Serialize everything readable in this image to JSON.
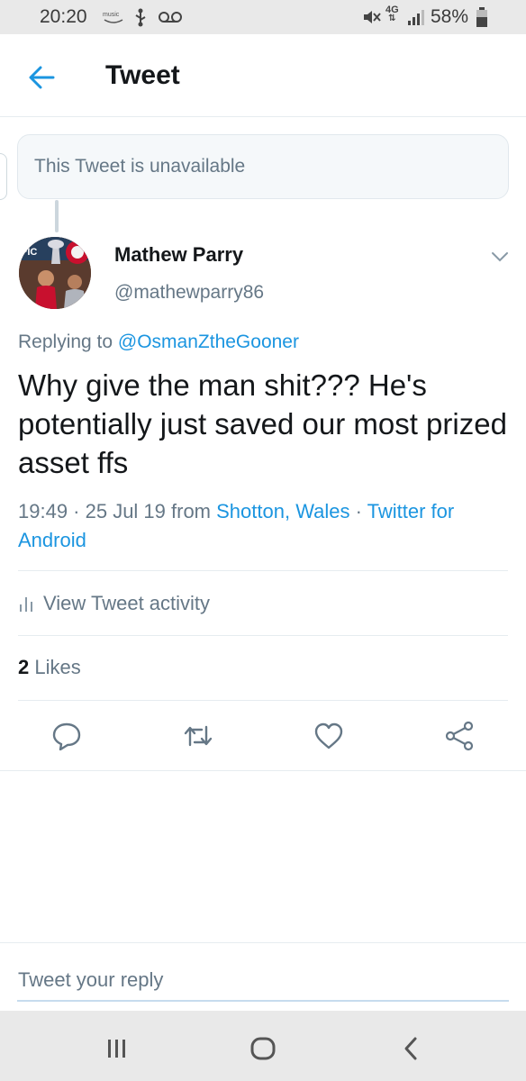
{
  "status_bar": {
    "time": "20:20",
    "network": "4G",
    "battery": "58%",
    "icons": [
      "music-notification-icon",
      "usb-icon",
      "voicemail-icon",
      "mute-icon",
      "signal-icon",
      "battery-icon"
    ]
  },
  "header": {
    "title": "Tweet",
    "back_icon": "arrow-left-icon"
  },
  "parent_tweet": {
    "text": "This Tweet is unavailable"
  },
  "tweet": {
    "author_name": "Mathew Parry",
    "author_handle": "@mathewparry86",
    "replying_prefix": "Replying to ",
    "replying_to": "@OsmanZtheGooner",
    "text": "Why give the man shit??? He's potentially just saved our most prized asset ffs",
    "time": "19:49 · 25 Jul 19 from ",
    "location": "Shotton, Wales",
    "separator": " · ",
    "client": "Twitter for Android",
    "activity_label": "View Tweet activity",
    "likes_count": "2",
    "likes_label": " Likes"
  },
  "actions": [
    "reply-icon",
    "retweet-icon",
    "like-icon",
    "share-icon"
  ],
  "reply_box": {
    "placeholder": "Tweet your reply"
  },
  "nav": [
    "recents-icon",
    "home-icon",
    "back-icon"
  ],
  "colors": {
    "accent": "#1b95e0",
    "secondary_text": "#657786",
    "divider": "#e6ecf0",
    "system_bar": "#e9e9e9"
  }
}
